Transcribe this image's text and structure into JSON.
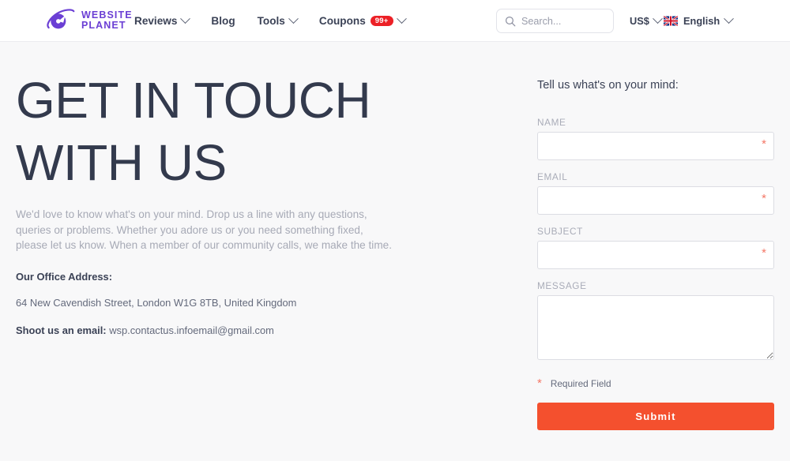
{
  "header": {
    "logo": {
      "line1": "WEBSITE",
      "line2": "PLANET",
      "icon": "planet-logo-icon",
      "color": "#6b3fd4"
    },
    "nav": [
      {
        "label": "Reviews",
        "has_caret": true,
        "badge": null
      },
      {
        "label": "Blog",
        "has_caret": false,
        "badge": null
      },
      {
        "label": "Tools",
        "has_caret": true,
        "badge": null
      },
      {
        "label": "Coupons",
        "has_caret": true,
        "badge": "99+"
      }
    ],
    "search": {
      "placeholder": "Search...",
      "value": "",
      "icon": "search-icon"
    },
    "currency": {
      "label": "US$",
      "has_caret": true
    },
    "language": {
      "label": "English",
      "flag": "uk-flag-icon",
      "has_caret": true
    }
  },
  "hero": {
    "headline": "GET IN TOUCH WITH US",
    "intro": "We'd love to know what's on your mind. Drop us a line with any questions, queries or problems. Whether you adore us or you need something fixed, please let us know. When a member of our community calls, we make the time.",
    "office_address_title": "Our Office Address:",
    "office_address": "64 New Cavendish Street, London W1G 8TB, United Kingdom",
    "email_label": "Shoot us an email:",
    "email_value": "wsp.contactus.infoemail@gmail.com"
  },
  "form": {
    "title": "Tell us what's on your mind:",
    "fields": [
      {
        "label": "NAME",
        "value": "",
        "placeholder": "",
        "required": true,
        "type": "text"
      },
      {
        "label": "EMAIL",
        "value": "",
        "placeholder": "",
        "required": true,
        "type": "text"
      },
      {
        "label": "SUBJECT",
        "value": "",
        "placeholder": "",
        "required": true,
        "type": "text"
      },
      {
        "label": "MESSAGE",
        "value": "",
        "placeholder": "",
        "required": false,
        "type": "textarea"
      }
    ],
    "required_star": "*",
    "required_note": "Required Field",
    "submit_label": "Submit",
    "submit_color": "#f4502e"
  },
  "colors": {
    "page_background": "#f8f8f9",
    "header_background": "#ffffff",
    "heading_text": "#333a4d",
    "muted_text": "#a7aab6",
    "accent_purple": "#6b3fd4",
    "accent_orange": "#f4502e",
    "badge_red": "#ec2026",
    "required_star": "#f47766"
  }
}
